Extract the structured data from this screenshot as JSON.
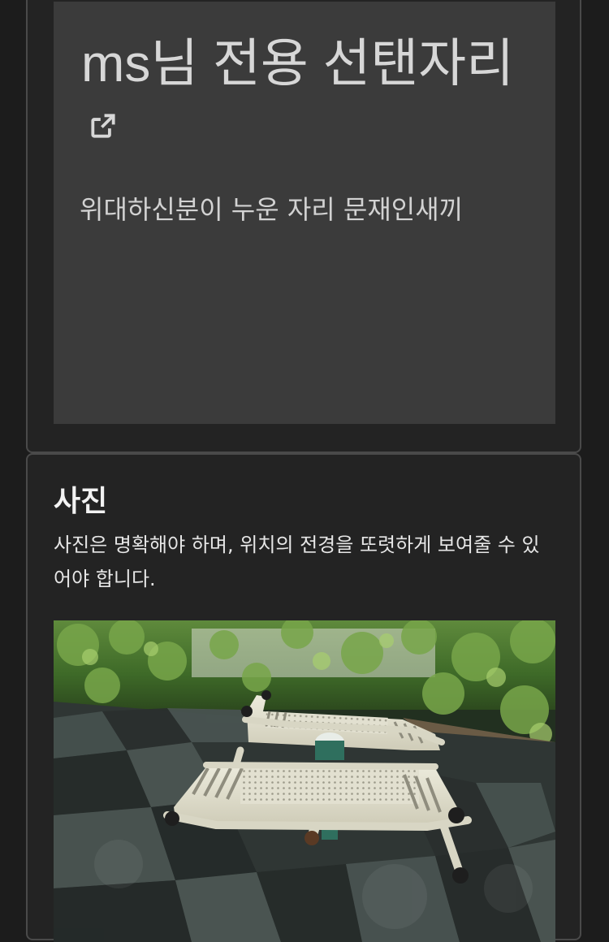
{
  "preview": {
    "title": "ms님 전용 선탠자리",
    "link_icon": "external-link-icon",
    "description": "위대하신분이 누운 자리 문재인새끼"
  },
  "photo_section": {
    "title": "사진",
    "description": "사진은 명확해야 하며, 위치의 전경을 또렷하게 보여줄 수 있어야 합니다.",
    "image_icon": "photo-outdoor-sun-loungers"
  },
  "colors": {
    "page_background": "#1c1c1c",
    "card_background": "#232323",
    "preview_background": "#3b3b3b",
    "card_border": "#4a4a4a"
  }
}
